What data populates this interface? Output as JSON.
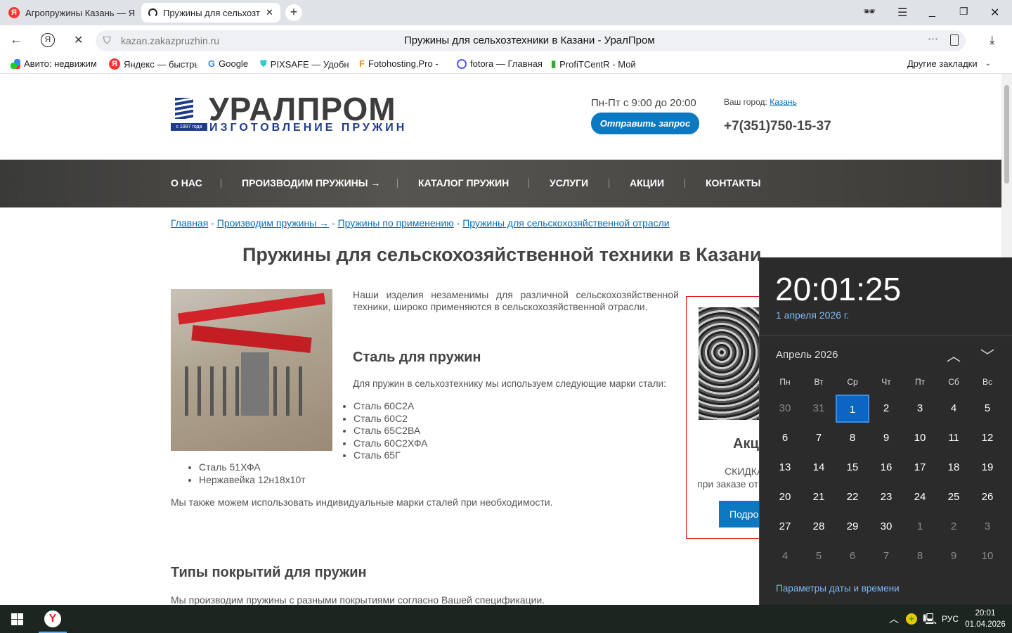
{
  "browser": {
    "tabs": [
      {
        "label": "Агропружины Казань — Я",
        "active": false
      },
      {
        "label": "Пружины для сельхозт",
        "active": true
      }
    ],
    "url": "kazan.zakazpruzhin.ru",
    "page_title": "Пружины для сельхозтехники в Казани - УралПром",
    "bookmarks": [
      "Авито: недвижим",
      "Яндекс — быстры",
      "Google",
      "PIXSAFE — Удобн",
      "Fotohosting.Pro -",
      "fotora — Главная",
      "ProfiTCentR - Мой"
    ],
    "other_bookmarks": "Другие закладки"
  },
  "site": {
    "logo_main": "УРАЛПРОМ",
    "logo_sub": "ИЗГОТОВЛЕНИЕ ПРУЖИН",
    "logo_year": "с 1997 года",
    "hours": "Пн-Пт с 9:00 до 20:00",
    "request_button": "Отправить запрос",
    "city_label": "Ваш город:",
    "city": "Казань",
    "phone": "+7(351)750-15-37",
    "nav": [
      "О НАС",
      "ПРОИЗВОДИМ ПРУЖИНЫ →",
      "КАТАЛОГ ПРУЖИН",
      "УСЛУГИ",
      "АКЦИИ",
      "КОНТАКТЫ"
    ],
    "breadcrumbs": [
      "Главная",
      "Производим пружины →",
      "Пружины по применению",
      "Пружины для сельскохозяйственной отрасли"
    ],
    "heading": "Пружины для сельскохозяйственной техники в Казани",
    "intro": "Наши изделия незаменимы для различной сельскохозяйственной техники, широко применяются в сельскохозяйственной отрасли.",
    "steel_heading": "Сталь для пружин",
    "steel_intro": "Для пружин в сельхозтехнику мы используем следующие марки стали:",
    "steels": [
      "Сталь 60С2А",
      "Сталь 60С2",
      "Сталь 65С2ВА",
      "Сталь 60С2ХФА",
      "Сталь 65Г",
      "Сталь 51ХФА",
      "Нержавейка 12н18х10т"
    ],
    "custom_note": "Мы также можем использовать индивидуальные марки сталей при необходимости.",
    "coating_heading": "Типы покрытий для пружин",
    "coating_text": "Мы производим пружины с разными покрытиями согласно Вашей спецификации.",
    "promo": {
      "title": "Акц",
      "line1": "СКИДКА",
      "line2": "при заказе от",
      "button": "Подро"
    }
  },
  "clock": {
    "time": "20:01:25",
    "date": "1 апреля 2026 г.",
    "month": "Апрель 2026",
    "weekdays": [
      "Пн",
      "Вт",
      "Ср",
      "Чт",
      "Пт",
      "Сб",
      "Вс"
    ],
    "days": [
      30,
      31,
      1,
      2,
      3,
      4,
      5,
      6,
      7,
      8,
      9,
      10,
      11,
      12,
      13,
      14,
      15,
      16,
      17,
      18,
      19,
      20,
      21,
      22,
      23,
      24,
      25,
      26,
      27,
      28,
      29,
      30,
      1,
      2,
      3,
      4,
      5,
      6,
      7,
      8,
      9,
      10
    ],
    "current_month_range": [
      2,
      31
    ],
    "today_index": 2,
    "settings_link": "Параметры даты и времени"
  },
  "taskbar": {
    "lang": "РУС",
    "time": "20:01",
    "date": "01.04.2026"
  }
}
